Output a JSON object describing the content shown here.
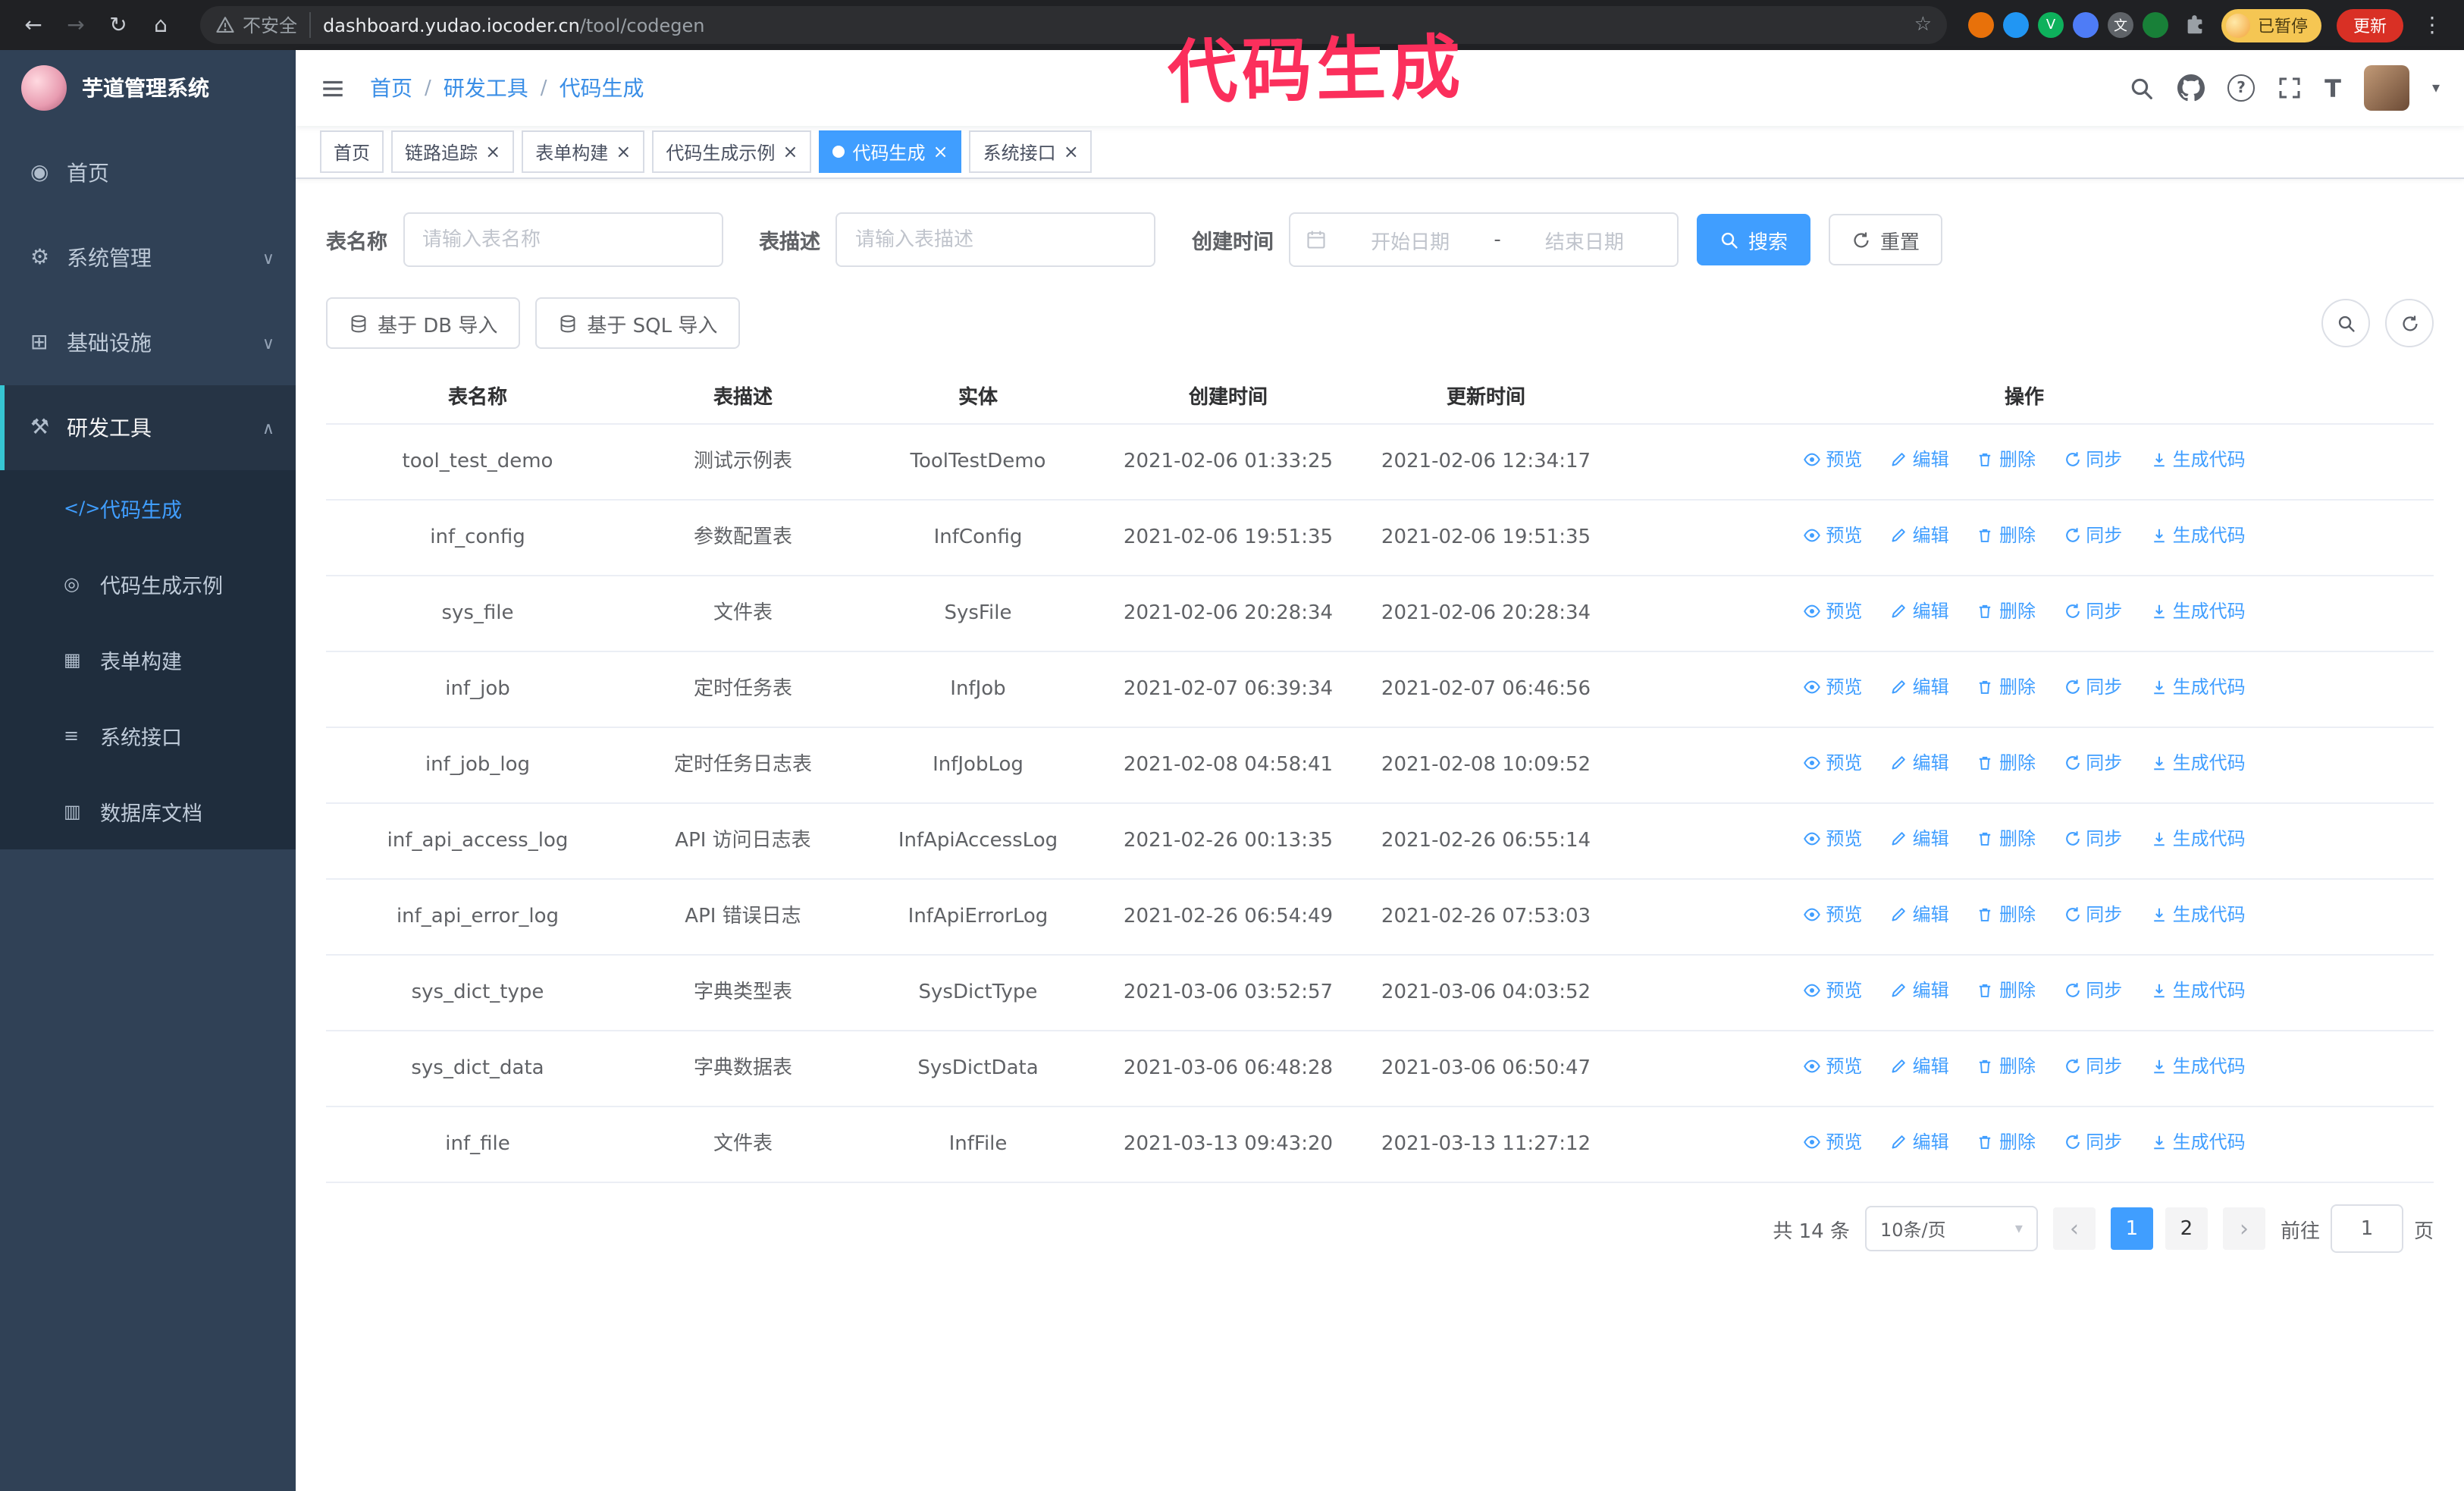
{
  "annotation": "代码生成",
  "browser": {
    "security_label": "不安全",
    "url_host": "dashboard.yudao.iocoder.cn",
    "url_path": "/tool/codegen",
    "profile_status": "已暂停",
    "update_label": "更新",
    "extensions": [
      {
        "name": "ext-orange",
        "bg": "#e8710a",
        "glyph": ""
      },
      {
        "name": "ext-blue-drop",
        "bg": "#2196f3",
        "glyph": ""
      },
      {
        "name": "ext-green-v",
        "bg": "#0eb15c",
        "glyph": "V"
      },
      {
        "name": "ext-blue-people",
        "bg": "#4e7cf6",
        "glyph": ""
      },
      {
        "name": "ext-gray-translate",
        "bg": "#5f6368",
        "glyph": "文"
      },
      {
        "name": "ext-green-leaf",
        "bg": "#188038",
        "glyph": ""
      }
    ]
  },
  "glyphs": {
    "back": "←",
    "forward": "→",
    "reload": "↻",
    "home": "⌂",
    "star": "☆",
    "kebab": "⋮",
    "caret": "▾",
    "close": "×",
    "question": "?",
    "fontsize": "T",
    "slash": "/",
    "prev": "‹",
    "next": "›",
    "dash": "-"
  },
  "sidebar": {
    "logo_title": "芋道管理系统",
    "menu": [
      {
        "label": "首页",
        "glyph": "◉",
        "chev": ""
      },
      {
        "label": "系统管理",
        "glyph": "⚙",
        "chev": "∨"
      },
      {
        "label": "基础设施",
        "glyph": "⊞",
        "chev": "∨"
      },
      {
        "label": "研发工具",
        "glyph": "⚒",
        "chev": "∧",
        "cls": "open"
      }
    ],
    "submenu": [
      {
        "label": "代码生成",
        "glyph": "</>",
        "active": true
      },
      {
        "label": "代码生成示例",
        "glyph": "◎"
      },
      {
        "label": "表单构建",
        "glyph": "▦"
      },
      {
        "label": "系统接口",
        "glyph": "≡"
      },
      {
        "label": "数据库文档",
        "glyph": "▥"
      }
    ]
  },
  "navbar": {
    "breadcrumb": [
      "首页",
      "研发工具",
      "代码生成"
    ]
  },
  "tags": [
    {
      "label": "首页"
    },
    {
      "label": "链路追踪",
      "closable": true
    },
    {
      "label": "表单构建",
      "closable": true
    },
    {
      "label": "代码生成示例",
      "closable": true
    },
    {
      "label": "代码生成",
      "closable": true,
      "active": true
    },
    {
      "label": "系统接口",
      "closable": true
    }
  ],
  "filters": {
    "table_name_label": "表名称",
    "table_name_placeholder": "请输入表名称",
    "table_desc_label": "表描述",
    "table_desc_placeholder": "请输入表描述",
    "create_time_label": "创建时间",
    "date_start_placeholder": "开始日期",
    "date_end_placeholder": "结束日期",
    "search_button": "搜索",
    "reset_button": "重置"
  },
  "toolbar": {
    "import_db": "基于 DB 导入",
    "import_sql": "基于 SQL 导入"
  },
  "table": {
    "columns": [
      "表名称",
      "表描述",
      "实体",
      "创建时间",
      "更新时间",
      "操作"
    ],
    "op_labels": [
      "预览",
      "编辑",
      "删除",
      "同步",
      "生成代码"
    ],
    "rows": [
      {
        "name": "tool_test_demo",
        "desc": "测试示例表",
        "entity": "ToolTestDemo",
        "created": "2021-02-06 01:33:25",
        "updated": "2021-02-06 12:34:17"
      },
      {
        "name": "inf_config",
        "desc": "参数配置表",
        "entity": "InfConfig",
        "created": "2021-02-06 19:51:35",
        "updated": "2021-02-06 19:51:35"
      },
      {
        "name": "sys_file",
        "desc": "文件表",
        "entity": "SysFile",
        "created": "2021-02-06 20:28:34",
        "updated": "2021-02-06 20:28:34"
      },
      {
        "name": "inf_job",
        "desc": "定时任务表",
        "entity": "InfJob",
        "created": "2021-02-07 06:39:34",
        "updated": "2021-02-07 06:46:56"
      },
      {
        "name": "inf_job_log",
        "desc": "定时任务日志表",
        "entity": "InfJobLog",
        "created": "2021-02-08 04:58:41",
        "updated": "2021-02-08 10:09:52"
      },
      {
        "name": "inf_api_access_log",
        "desc": "API 访问日志表",
        "entity": "InfApiAccessLog",
        "created": "2021-02-26 00:13:35",
        "updated": "2021-02-26 06:55:14"
      },
      {
        "name": "inf_api_error_log",
        "desc": "API 错误日志",
        "entity": "InfApiErrorLog",
        "created": "2021-02-26 06:54:49",
        "updated": "2021-02-26 07:53:03"
      },
      {
        "name": "sys_dict_type",
        "desc": "字典类型表",
        "entity": "SysDictType",
        "created": "2021-03-06 03:52:57",
        "updated": "2021-03-06 04:03:52"
      },
      {
        "name": "sys_dict_data",
        "desc": "字典数据表",
        "entity": "SysDictData",
        "created": "2021-03-06 06:48:28",
        "updated": "2021-03-06 06:50:47"
      },
      {
        "name": "inf_file",
        "desc": "文件表",
        "entity": "InfFile",
        "created": "2021-03-13 09:43:20",
        "updated": "2021-03-13 11:27:12"
      }
    ]
  },
  "pagination": {
    "total_label": "共 14 条",
    "page_size": "10条/页",
    "pages": [
      {
        "label": "1",
        "active": true
      },
      {
        "label": "2"
      }
    ],
    "goto_label": "前往",
    "goto_value": "1",
    "goto_suffix": "页"
  },
  "colors": {
    "primary": "#409EFF",
    "sidebar_bg": "#304156",
    "submenu_bg": "#1f2d3d",
    "tag_active": "#409EFF",
    "annotation": "#FB2F5C"
  }
}
